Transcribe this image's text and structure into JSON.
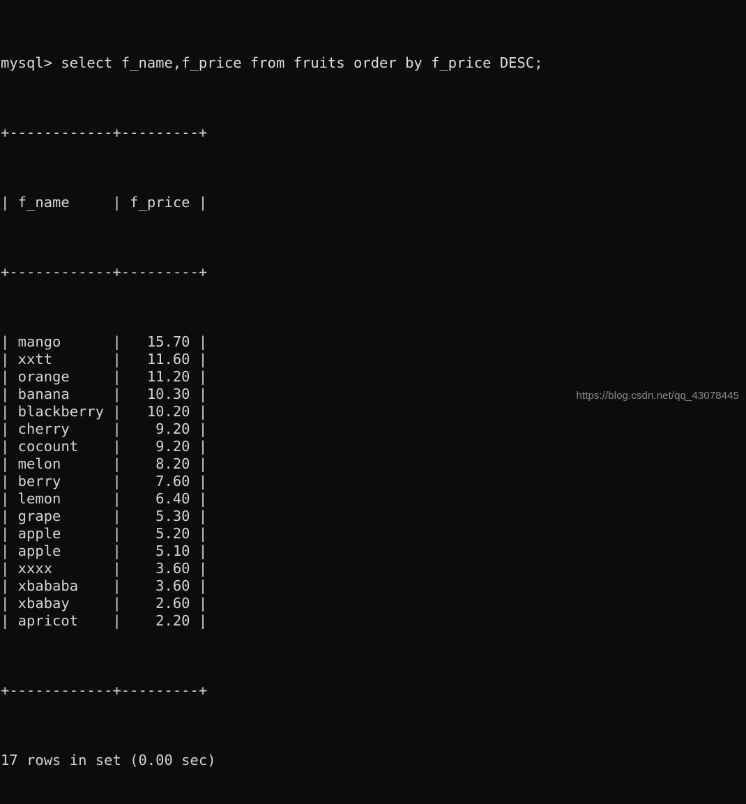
{
  "terminal": {
    "prompt": "mysql> ",
    "query": "select f_name,f_price from fruits order by f_price DESC;",
    "command_line": "mysql> select f_name,f_price from fruits order by f_price DESC;",
    "separator": "+------------+---------+",
    "header_row": "| f_name     | f_price |",
    "footer_status": "17 rows in set (0.00 sec)",
    "row_count": 17,
    "elapsed": "0.00 sec",
    "columns": [
      "f_name",
      "f_price"
    ],
    "rows": [
      {
        "f_name": "mango",
        "f_price": "15.70",
        "line": "| mango      |   15.70 |"
      },
      {
        "f_name": "xxtt",
        "f_price": "11.60",
        "line": "| xxtt       |   11.60 |"
      },
      {
        "f_name": "orange",
        "f_price": "11.20",
        "line": "| orange     |   11.20 |"
      },
      {
        "f_name": "banana",
        "f_price": "10.30",
        "line": "| banana     |   10.30 |"
      },
      {
        "f_name": "blackberry",
        "f_price": "10.20",
        "line": "| blackberry |   10.20 |"
      },
      {
        "f_name": "cherry",
        "f_price": "9.20",
        "line": "| cherry     |    9.20 |"
      },
      {
        "f_name": "cocount",
        "f_price": "9.20",
        "line": "| cocount    |    9.20 |"
      },
      {
        "f_name": "melon",
        "f_price": "8.20",
        "line": "| melon      |    8.20 |"
      },
      {
        "f_name": "berry",
        "f_price": "7.60",
        "line": "| berry      |    7.60 |"
      },
      {
        "f_name": "lemon",
        "f_price": "6.40",
        "line": "| lemon      |    6.40 |"
      },
      {
        "f_name": "grape",
        "f_price": "5.30",
        "line": "| grape      |    5.30 |"
      },
      {
        "f_name": "apple",
        "f_price": "5.20",
        "line": "| apple      |    5.20 |"
      },
      {
        "f_name": "apple",
        "f_price": "5.10",
        "line": "| apple      |    5.10 |"
      },
      {
        "f_name": "xxxx",
        "f_price": "3.60",
        "line": "| xxxx       |    3.60 |"
      },
      {
        "f_name": "xbababa",
        "f_price": "3.60",
        "line": "| xbababa    |    3.60 |"
      },
      {
        "f_name": "xbabay",
        "f_price": "2.60",
        "line": "| xbabay     |    2.60 |"
      },
      {
        "f_name": "apricot",
        "f_price": "2.20",
        "line": "| apricot    |    2.20 |"
      }
    ]
  },
  "watermark": {
    "text": "https://blog.csdn.net/qq_43078445"
  },
  "colors": {
    "background": "#0c0c0c",
    "foreground": "#d4d4d4",
    "watermark": "#8a8a8a"
  }
}
